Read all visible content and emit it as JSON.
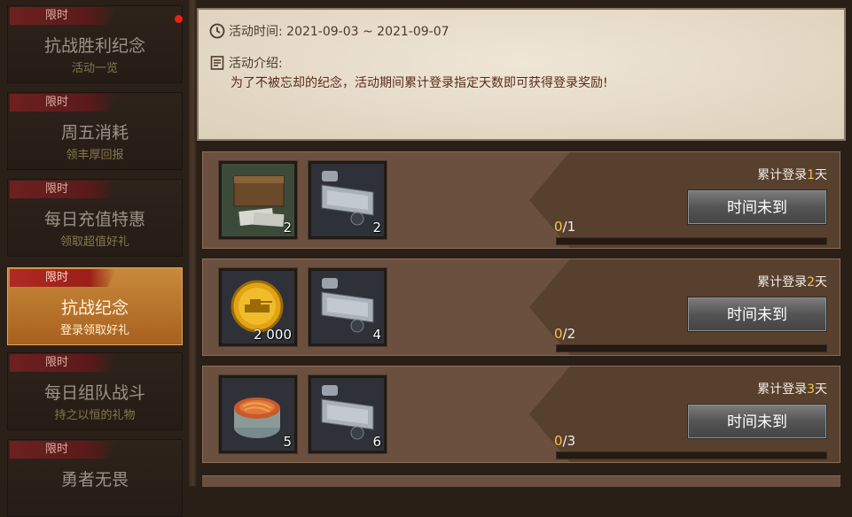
{
  "sidebar": {
    "items": [
      {
        "tag": "限时",
        "title": "抗战胜利纪念",
        "sub": "活动一览"
      },
      {
        "tag": "限时",
        "title": "周五消耗",
        "sub": "领丰厚回报"
      },
      {
        "tag": "限时",
        "title": "每日充值特惠",
        "sub": "领取超值好礼"
      },
      {
        "tag": "限时",
        "title": "抗战纪念",
        "sub": "登录领取好礼"
      },
      {
        "tag": "限时",
        "title": "每日组队战斗",
        "sub": "持之以恒的礼物"
      },
      {
        "tag": "限时",
        "title": "勇者无畏",
        "sub": ""
      }
    ],
    "active_index": 3
  },
  "info": {
    "time_label": "活动时间: 2021-09-03 ~ 2021-09-07",
    "intro_label": "活动介绍:",
    "intro_text": "为了不被忘却的纪念，活动期间累计登录指定天数即可获得登录奖励!"
  },
  "rewards": [
    {
      "day_prefix": "累计登录",
      "day_num": "1",
      "day_suffix": "天",
      "item1_icon": "supply-crate-icon",
      "item1_qty": "2",
      "item2_icon": "armor-plate-icon",
      "item2_qty": "2",
      "button": "时间未到",
      "progress_cur": "0",
      "progress_total": "/1",
      "progress": 0
    },
    {
      "day_prefix": "累计登录",
      "day_num": "2",
      "day_suffix": "天",
      "item1_icon": "gold-coin-icon",
      "item1_qty": "2 000",
      "item2_icon": "armor-plate-icon",
      "item2_qty": "4",
      "button": "时间未到",
      "progress_cur": "0",
      "progress_total": "/2",
      "progress": 0
    },
    {
      "day_prefix": "累计登录",
      "day_num": "3",
      "day_suffix": "天",
      "item1_icon": "noodle-tin-icon",
      "item1_qty": "5",
      "item2_icon": "armor-plate-icon",
      "item2_qty": "6",
      "button": "时间未到",
      "progress_cur": "0",
      "progress_total": "/3",
      "progress": 0
    }
  ],
  "colors": {
    "accent": "#f6c34a",
    "active_tab": "#b87a34",
    "tag_red": "#6e2020"
  }
}
